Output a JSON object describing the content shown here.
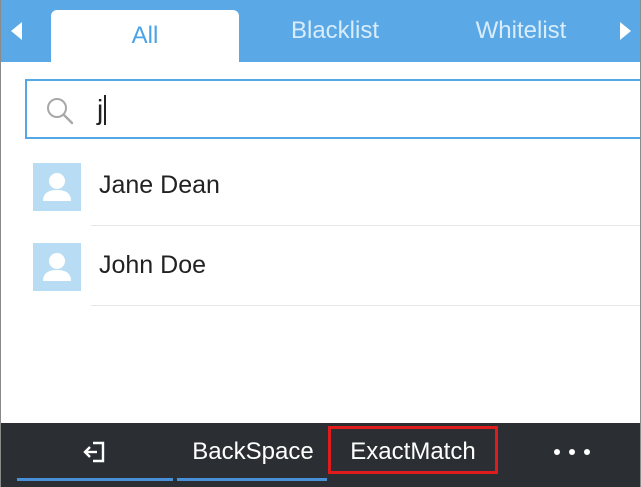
{
  "tabs": [
    {
      "label": "All",
      "active": true
    },
    {
      "label": "Blacklist",
      "active": false
    },
    {
      "label": "Whitelist",
      "active": false
    }
  ],
  "search": {
    "value": "j",
    "icon": "search-icon"
  },
  "contacts": [
    {
      "name": "Jane Dean",
      "icon": "person-icon"
    },
    {
      "name": "John Doe",
      "icon": "person-icon"
    }
  ],
  "softkeys": {
    "back_icon": "exit-icon",
    "backspace_label": "BackSpace",
    "exactmatch_label": "ExactMatch",
    "more_icon": "more-icon"
  },
  "colors": {
    "accent": "#5aa9e6",
    "softkey_bar": "#2b2f33",
    "highlight": "#e01b1b"
  }
}
